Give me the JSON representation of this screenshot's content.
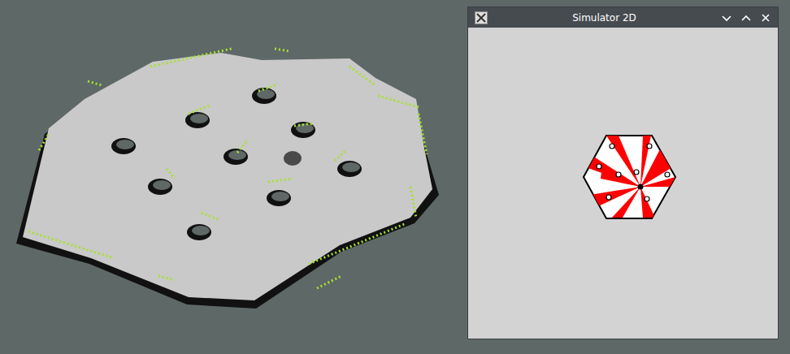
{
  "window": {
    "title": "Simulator 2D"
  }
}
